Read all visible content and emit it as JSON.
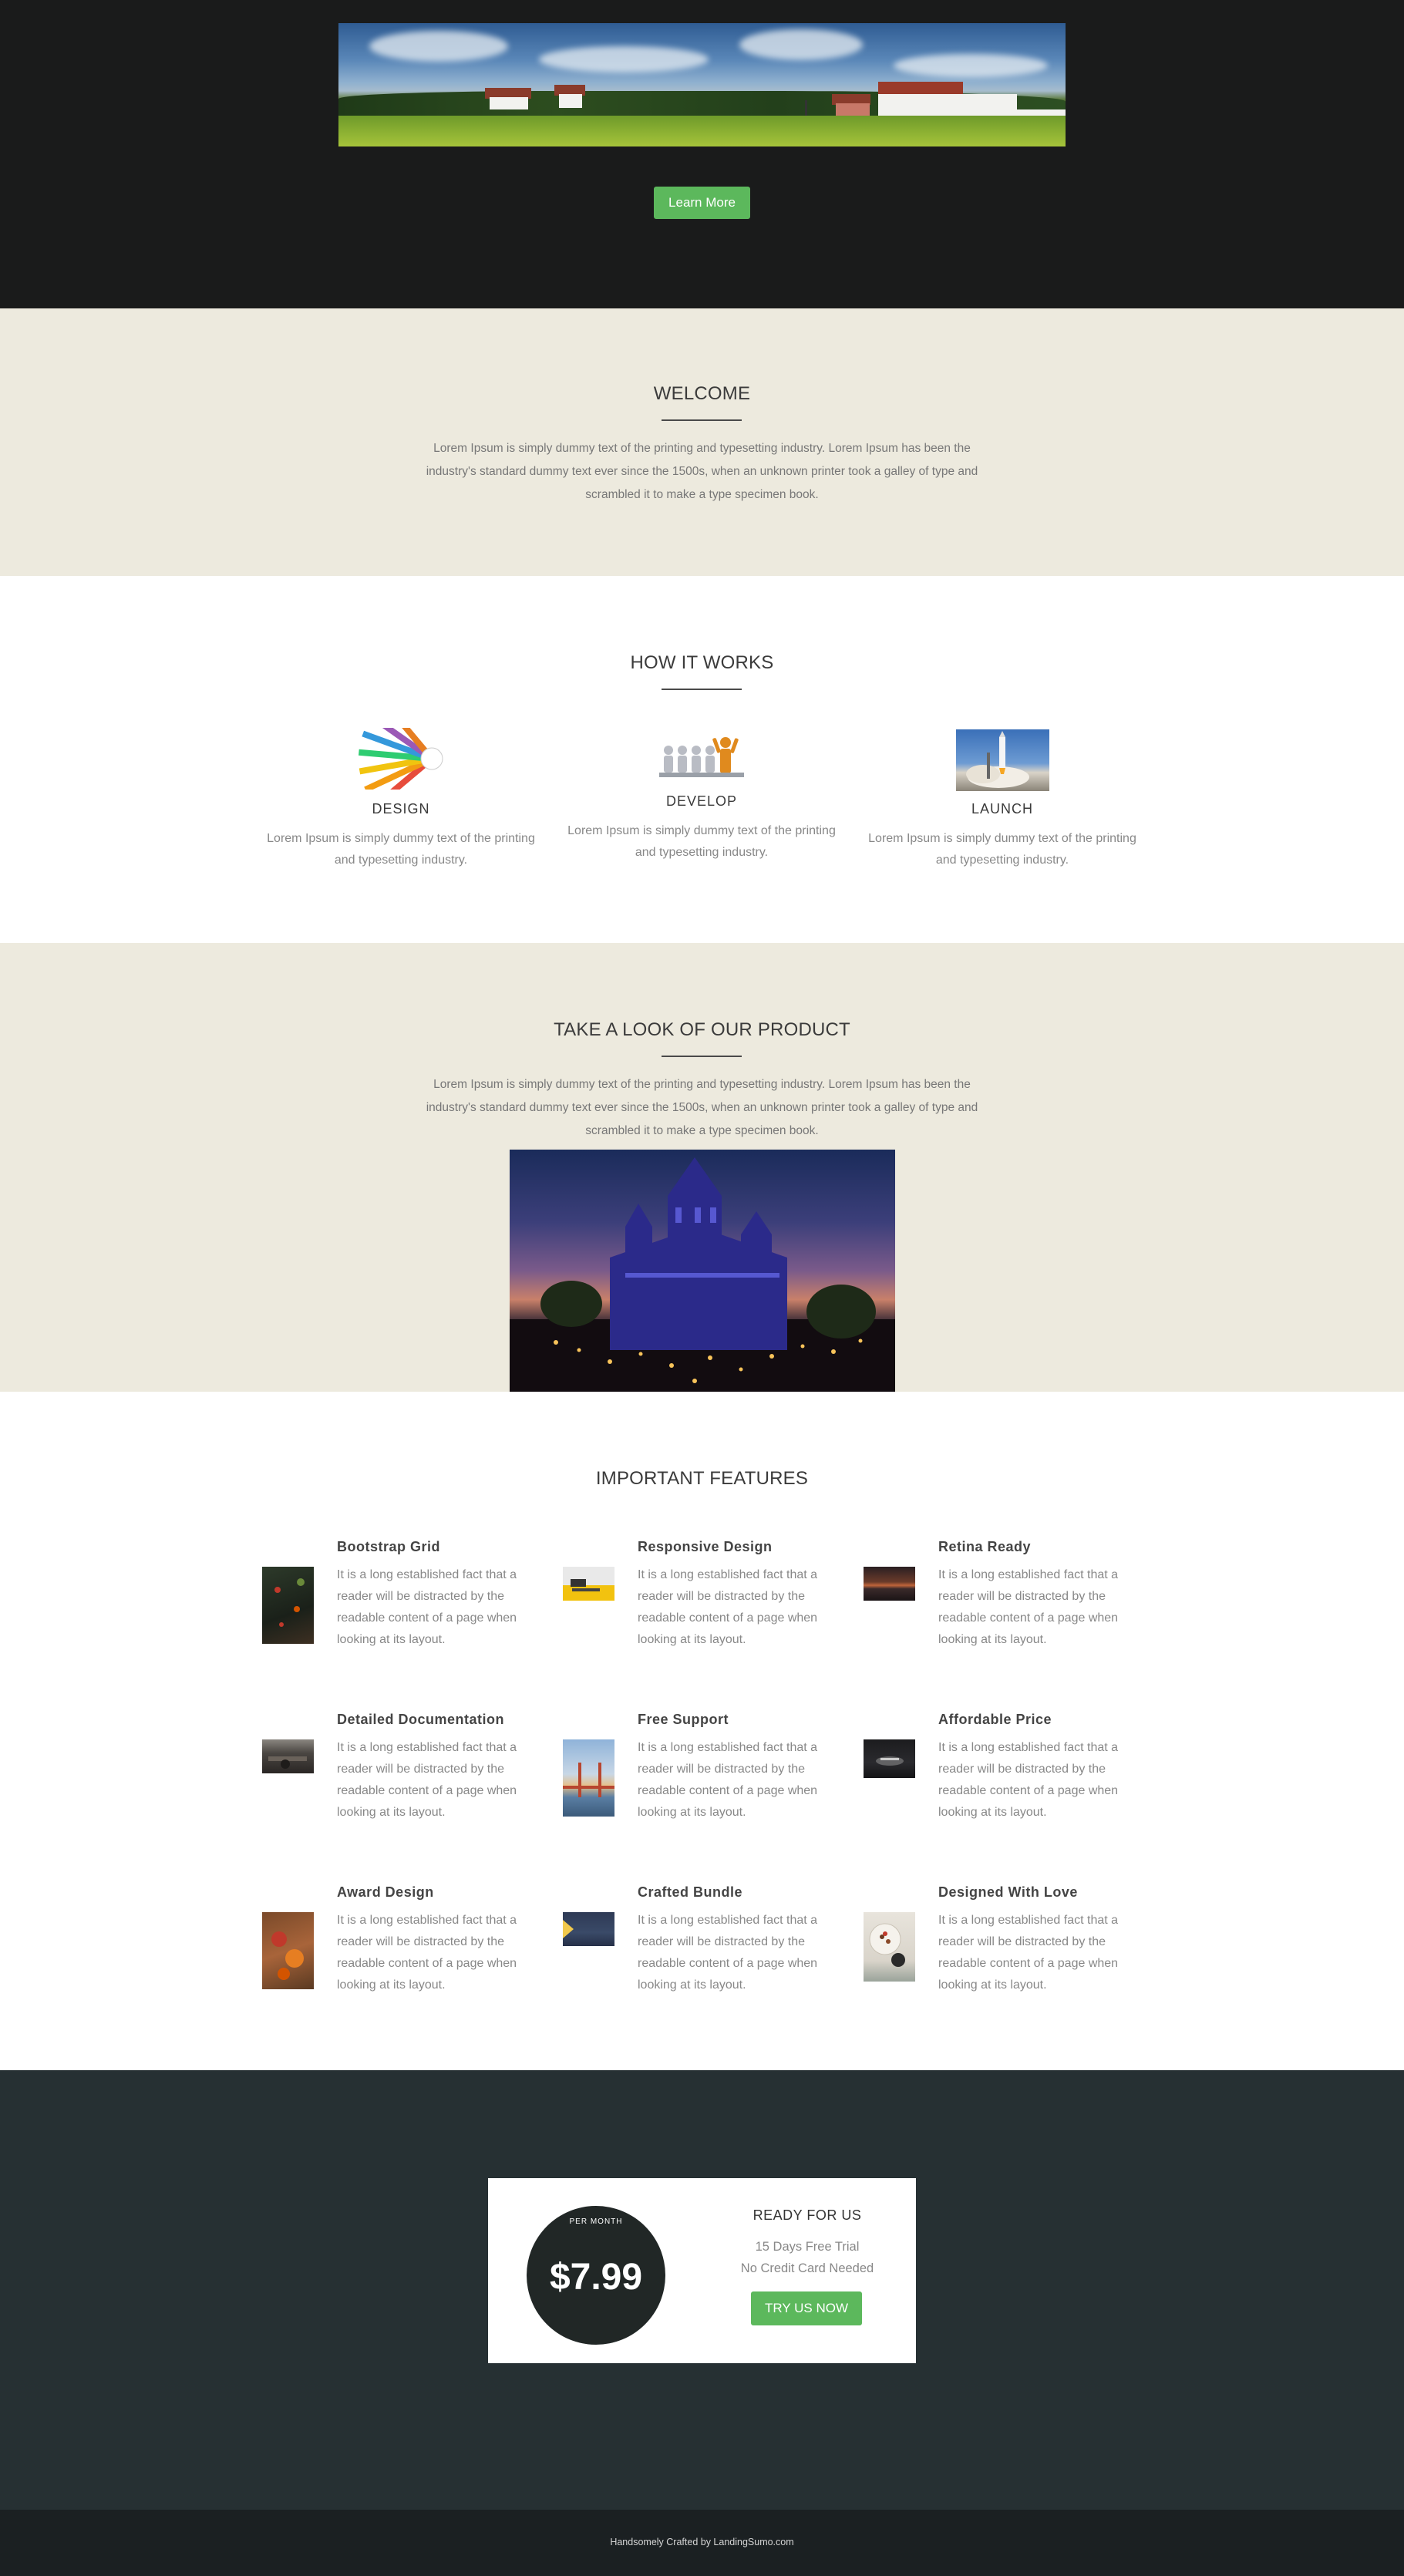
{
  "hero": {
    "banner_alt": "golf-course-clubhouse",
    "cta_label": "Learn More"
  },
  "welcome": {
    "title": "WELCOME",
    "text": "Lorem Ipsum is simply dummy text of the printing and typesetting industry. Lorem Ipsum has been the industry's standard dummy text ever since the 1500s, when an unknown printer took a galley of type and scrambled it to make a type specimen book."
  },
  "how_it_works": {
    "title": "HOW IT WORKS",
    "steps": [
      {
        "title": "DESIGN",
        "text": "Lorem Ipsum is simply dummy text of the printing and typesetting industry.",
        "icon": "colored-pencils-image"
      },
      {
        "title": "DEVELOP",
        "text": "Lorem Ipsum is simply dummy text of the printing and typesetting industry.",
        "icon": "figures-podium-image"
      },
      {
        "title": "LAUNCH",
        "text": "Lorem Ipsum is simply dummy text of the printing and typesetting industry.",
        "icon": "rocket-launch-image"
      }
    ]
  },
  "product": {
    "title": "TAKE A LOOK OF OUR PRODUCT",
    "text": "Lorem Ipsum is simply dummy text of the printing and typesetting industry. Lorem Ipsum has been the industry's standard dummy text ever since the 1500s, when an unknown printer took a galley of type and scrambled it to make a type specimen book.",
    "image": "illuminated-mansion-night-image"
  },
  "features": {
    "title": "IMPORTANT FEATURES",
    "items": [
      {
        "title": "Bootstrap Grid",
        "text": "It is a long established fact that a reader will be distracted by the readable content of a page when looking at its layout."
      },
      {
        "title": "Responsive Design",
        "text": "It is a long established fact that a reader will be distracted by the readable content of a page when looking at its layout."
      },
      {
        "title": "Retina Ready",
        "text": "It is a long established fact that a reader will be distracted by the readable content of a page when looking at its layout."
      },
      {
        "title": "Detailed Documentation",
        "text": "It is a long established fact that a reader will be distracted by the readable content of a page when looking at its layout."
      },
      {
        "title": "Free Support",
        "text": "It is a long established fact that a reader will be distracted by the readable content of a page when looking at its layout."
      },
      {
        "title": "Affordable Price",
        "text": "It is a long established fact that a reader will be distracted by the readable content of a page when looking at its layout."
      },
      {
        "title": "Award Design",
        "text": "It is a long established fact that a reader will be distracted by the readable content of a page when looking at its layout."
      },
      {
        "title": "Crafted Bundle",
        "text": "It is a long established fact that a reader will be distracted by the readable content of a page when looking at its layout."
      },
      {
        "title": "Designed With Love",
        "text": "It is a long established fact that a reader will be distracted by the readable content of a page when looking at its layout."
      }
    ]
  },
  "pricing": {
    "per_month": "PER MONTH",
    "price": "$7.99",
    "heading": "READY FOR US",
    "line1": "15 Days Free Trial",
    "line2": "No Credit Card Needed",
    "cta_label": "TRY US NOW"
  },
  "footer": {
    "text": "Handsomely Crafted by LandingSumo.com"
  },
  "colors": {
    "hero_bg": "#1a1b1b",
    "beige": "#edeade",
    "accent_green": "#5cb85c",
    "pricing_bg": "#263033",
    "footer_bg": "#1b2022"
  }
}
